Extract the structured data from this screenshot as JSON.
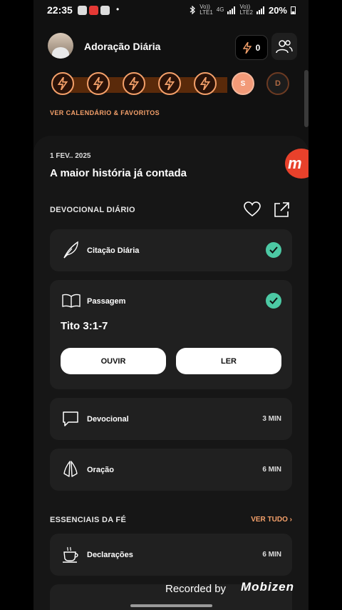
{
  "status_bar": {
    "time": "22:35",
    "dot": "•",
    "battery": "20%",
    "net1_top": "Vo))",
    "net1_bottom": "LTE1",
    "gen": "4G",
    "net2_top": "Vo))",
    "net2_bottom": "LTE2"
  },
  "header": {
    "app_title": "Adoração Diária",
    "streak_count": "0"
  },
  "calendar": {
    "days": [
      {
        "state": "done",
        "label": ""
      },
      {
        "state": "done",
        "label": ""
      },
      {
        "state": "done",
        "label": ""
      },
      {
        "state": "done",
        "label": ""
      },
      {
        "state": "done",
        "label": ""
      },
      {
        "state": "today",
        "label": "S"
      },
      {
        "state": "future",
        "label": "D"
      }
    ],
    "link": "VER CALENDÁRIO & FAVORITOS"
  },
  "devotional": {
    "date": "1 FEV.. 2025",
    "title": "A maior história já contada",
    "section_label": "DEVOCIONAL DIÁRIO",
    "items": {
      "quote": {
        "label": "Citação Diária",
        "completed": true
      },
      "passage": {
        "label": "Passagem",
        "reference": "Tito 3:1-7",
        "listen": "OUVIR",
        "read": "LER",
        "completed": true
      },
      "devotional": {
        "label": "Devocional",
        "duration": "3 MIN"
      },
      "prayer": {
        "label": "Oração",
        "duration": "6 MIN"
      }
    }
  },
  "essentials": {
    "section_label": "ESSENCIAIS DA FÉ",
    "see_all": "VER TUDO",
    "items": [
      {
        "label": "Declarações",
        "duration": "6 MIN"
      }
    ]
  },
  "overlay": {
    "recorded": "Recorded by",
    "brand": "Mobizen",
    "badge_letter": "m"
  },
  "colors": {
    "accent": "#f4a06a",
    "check": "#4cc9a4",
    "badge": "#e8412b"
  }
}
